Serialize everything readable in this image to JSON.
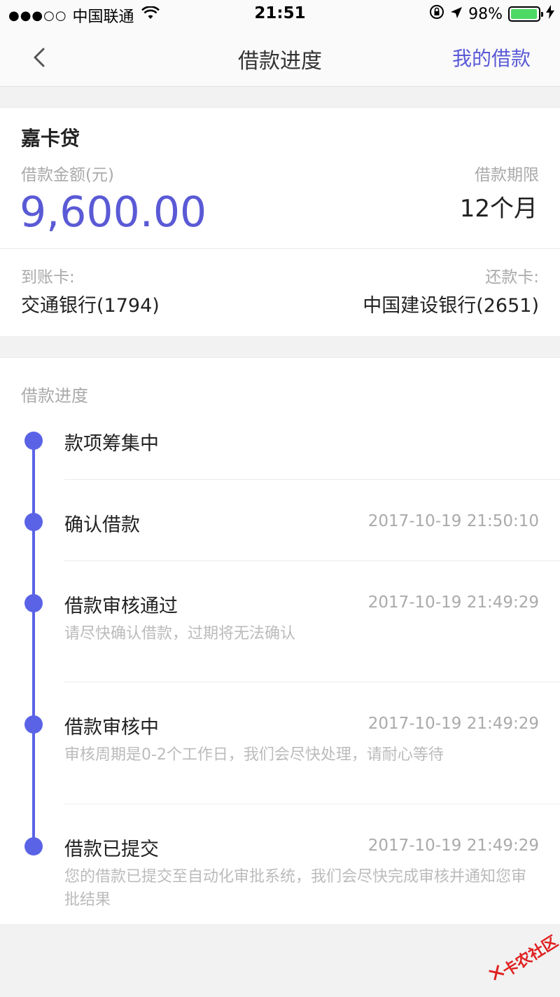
{
  "status_bar": {
    "signal": "●●●○○",
    "carrier": "中国联通",
    "time": "21:51",
    "battery": "98%",
    "battery_level": 0.98,
    "battery_color": "#4cd964"
  },
  "nav": {
    "title": "借款进度",
    "right_link": "我的借款",
    "accent": "#5a5ad6"
  },
  "loan": {
    "product": "嘉卡贷",
    "amount_label": "借款金额(元)",
    "amount": "9,600.00",
    "term_label": "借款期限",
    "term": "12个月",
    "receive_label": "到账卡:",
    "receive_card": "交通银行(1794)",
    "repay_label": "还款卡:",
    "repay_card": "中国建设银行(2651)"
  },
  "progress": {
    "label": "借款进度",
    "line_color": "#5a63e6",
    "steps": [
      {
        "title": "款项筹集中",
        "time": "",
        "desc": ""
      },
      {
        "title": "确认借款",
        "time": "2017-10-19 21:50:10",
        "desc": ""
      },
      {
        "title": "借款审核通过",
        "time": "2017-10-19 21:49:29",
        "desc": "请尽快确认借款，过期将无法确认"
      },
      {
        "title": "借款审核中",
        "time": "2017-10-19 21:49:29",
        "desc": "审核周期是0-2个工作日，我们会尽快处理，请耐心等待"
      },
      {
        "title": "借款已提交",
        "time": "2017-10-19 21:49:29",
        "desc": "您的借款已提交至自动化审批系统，我们会尽快完成审核并通知您审批结果"
      }
    ]
  },
  "watermark": {
    "text": "卡农社区"
  }
}
